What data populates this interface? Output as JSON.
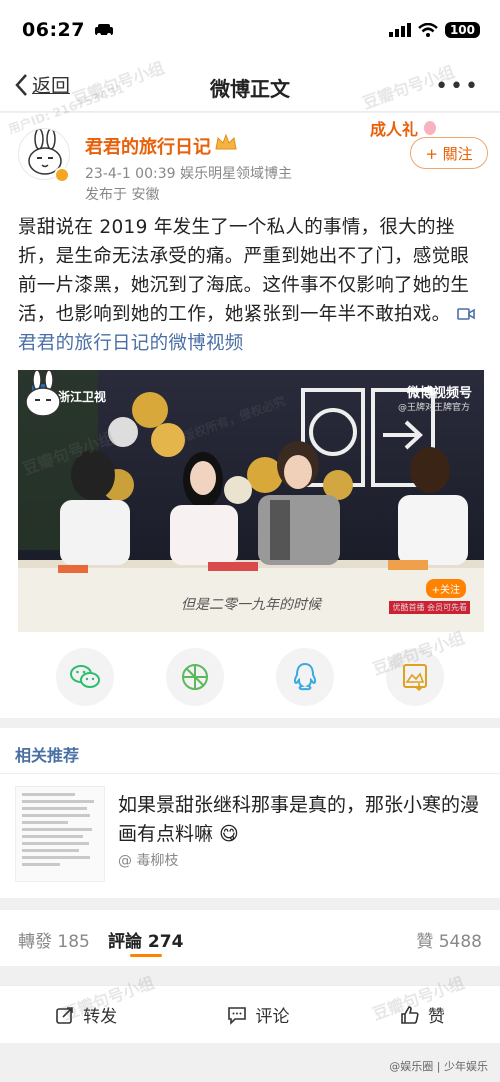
{
  "status_bar": {
    "time": "06:27",
    "battery": "100"
  },
  "nav": {
    "back_label": "返回",
    "title": "微博正文",
    "more": "•••"
  },
  "post": {
    "author": "君君的旅行日记",
    "meta": "23-4-1 00:39  娱乐明星领域博主",
    "location": "发布于 安徽",
    "follow_label": "+ 關注",
    "deco_text": "成人礼",
    "text": "景甜说在 2019 年发生了一个私人的事情，很大的挫折，是生命无法承受的痛。严重到她出不了门，感觉眼前一片漆黑，她沉到了海底。这件事不仅影响了她的生活，也影响到她的工作，她紧张到一年半不敢拍戏。",
    "video_link": "君君的旅行日记的微博视频",
    "video": {
      "channel_logo": "浙江卫视",
      "brand": "微博视频号",
      "brand_sub": "@王牌对王牌官方",
      "subtitle": "但是二零一九年的时候",
      "follow": "+关注",
      "source": "优酷首播 会员可先看"
    }
  },
  "share_icons": [
    "wechat-icon",
    "moments-icon",
    "qq-icon",
    "save-image-icon"
  ],
  "related": {
    "title": "相关推荐",
    "headline": "如果景甜张继科那事是真的，那张小寒的漫画有点料嘛 😋",
    "author": "@ 毒柳枝"
  },
  "tabs": {
    "repost": "轉發 185",
    "comment": "評論 274",
    "like": "贊 5488"
  },
  "actions": {
    "repost": "转发",
    "comment": "评论",
    "like": "赞"
  },
  "watermark": {
    "text": "豆瓣句号小组",
    "sub": "用户ID: 216753431",
    "rights": "版权所有，侵权必究"
  },
  "source_tag": "@娱乐圈 | 少年娱乐",
  "colors": {
    "accent": "#ff8200",
    "author": "#e8600a",
    "link": "#4a6fa5"
  }
}
